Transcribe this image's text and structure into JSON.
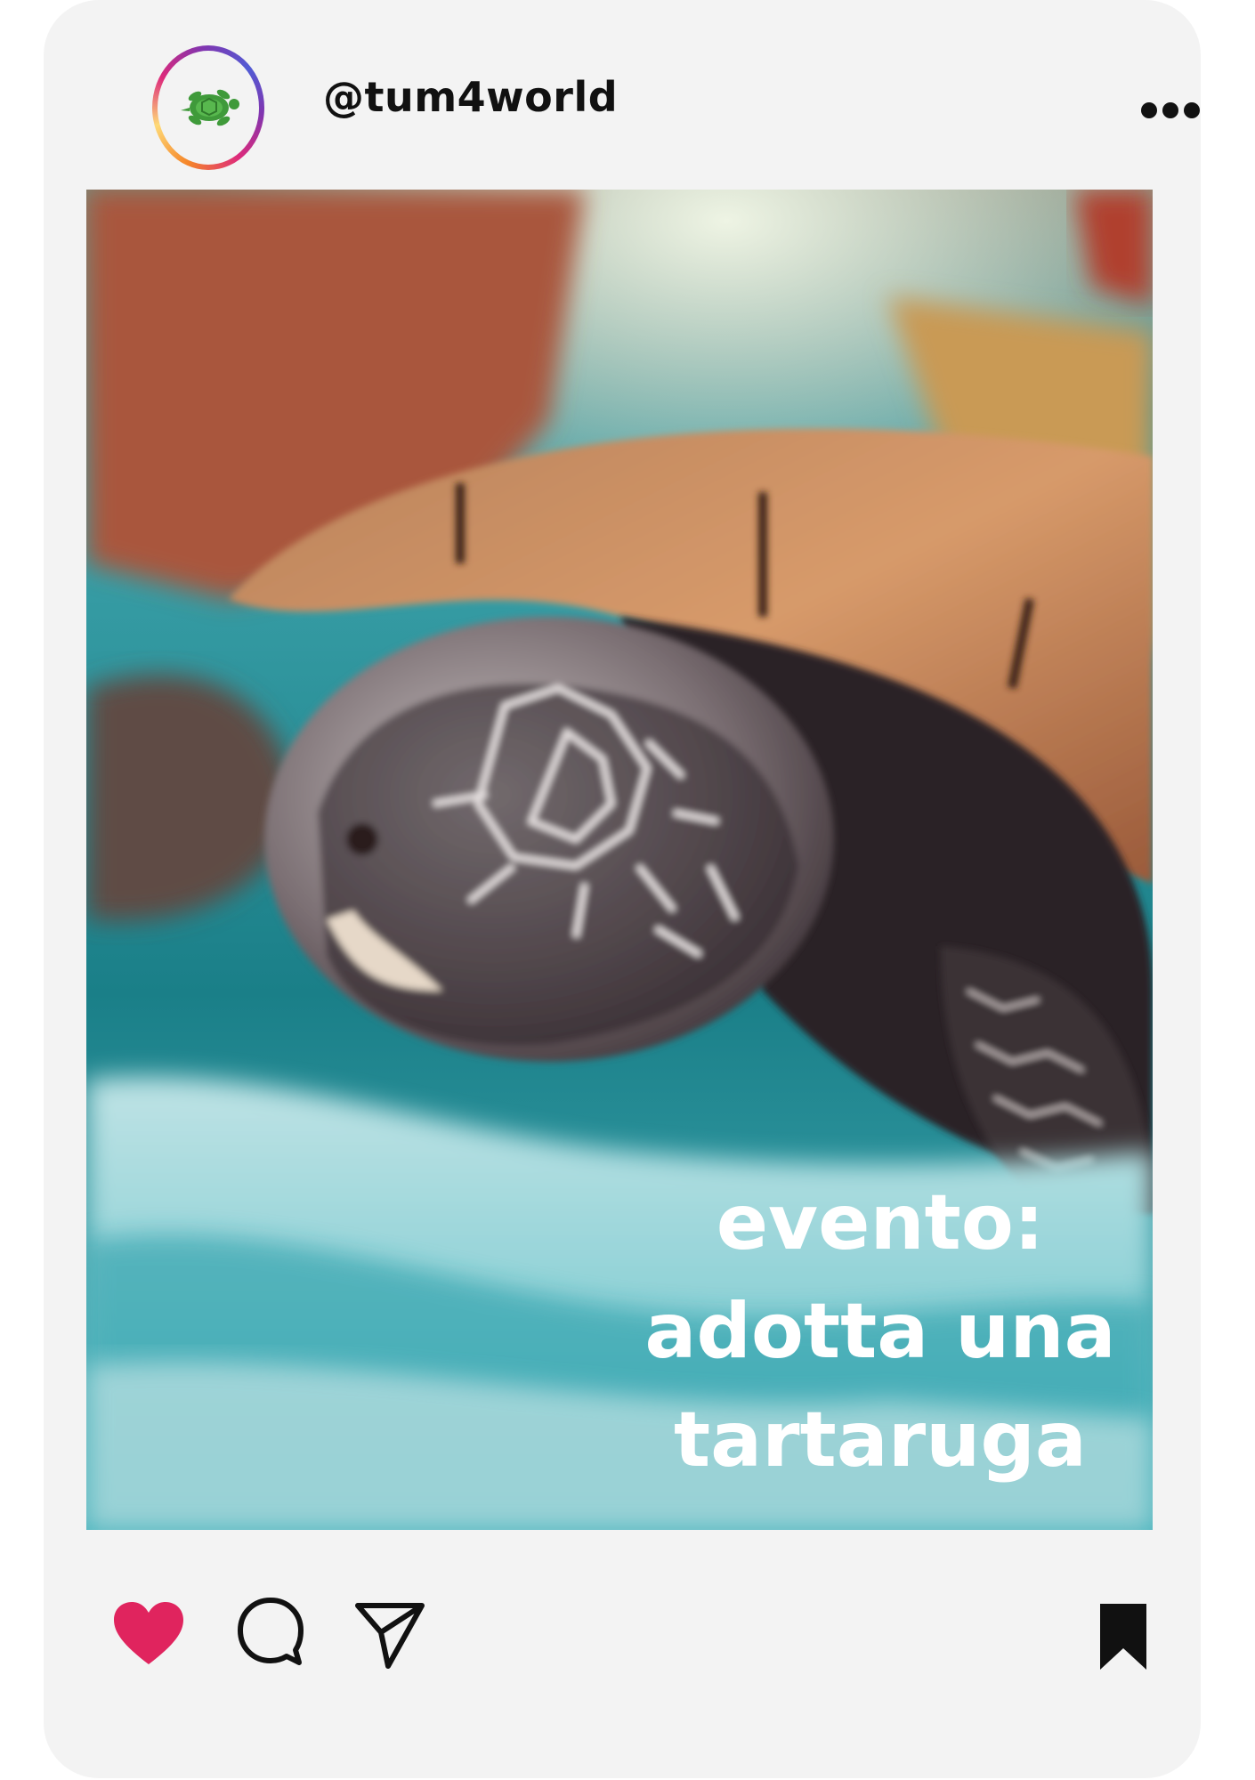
{
  "post": {
    "username": "@tum4world",
    "avatar_icon": "turtle-icon",
    "menu_icon": "more-dots-icon",
    "caption_lines": [
      "evento:",
      "adotta una",
      "tartaruga"
    ],
    "actions": {
      "like_icon": "heart-icon",
      "comment_icon": "comment-bubble-icon",
      "share_icon": "paper-plane-icon",
      "save_icon": "bookmark-icon"
    }
  },
  "colors": {
    "like": "#e0245e",
    "card": "#f3f3f3",
    "text": "#111111"
  }
}
